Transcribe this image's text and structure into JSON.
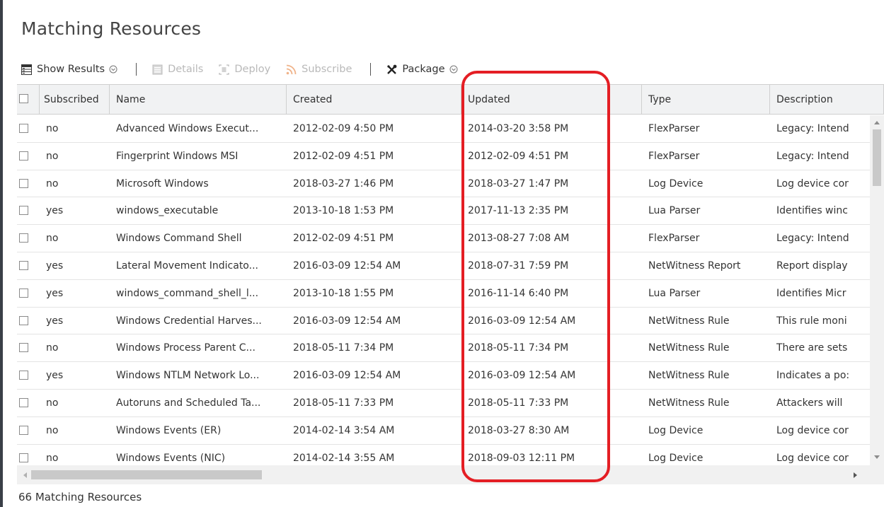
{
  "page": {
    "title": "Matching Resources",
    "footer_count": "66 Matching Resources"
  },
  "toolbar": {
    "show_results": "Show Results",
    "details": "Details",
    "deploy": "Deploy",
    "subscribe": "Subscribe",
    "package": "Package"
  },
  "columns": [
    "Subscribed",
    "Name",
    "Created",
    "Updated",
    "Type",
    "Description"
  ],
  "rows": [
    {
      "subscribed": "no",
      "name": "Advanced Windows Execut...",
      "created": "2012-02-09 4:50 PM",
      "updated": "2014-03-20 3:58 PM",
      "type": "FlexParser",
      "description": "Legacy: Intend"
    },
    {
      "subscribed": "no",
      "name": "Fingerprint Windows MSI",
      "created": "2012-02-09 4:51 PM",
      "updated": "2012-02-09 4:51 PM",
      "type": "FlexParser",
      "description": "Legacy: Intend"
    },
    {
      "subscribed": "no",
      "name": "Microsoft Windows",
      "created": "2018-03-27 1:46 PM",
      "updated": "2018-03-27 1:47 PM",
      "type": "Log Device",
      "description": "Log device cor"
    },
    {
      "subscribed": "yes",
      "name": "windows_executable",
      "created": "2013-10-18 1:53 PM",
      "updated": "2017-11-13 2:35 PM",
      "type": "Lua Parser",
      "description": "Identifies winc"
    },
    {
      "subscribed": "no",
      "name": "Windows Command Shell",
      "created": "2012-02-09 4:51 PM",
      "updated": "2013-08-27 7:08 AM",
      "type": "FlexParser",
      "description": "Legacy: Intend"
    },
    {
      "subscribed": "yes",
      "name": "Lateral Movement Indicato...",
      "created": "2016-03-09 12:54 AM",
      "updated": "2018-07-31 7:59 PM",
      "type": "NetWitness Report",
      "description": "Report display"
    },
    {
      "subscribed": "yes",
      "name": "windows_command_shell_l...",
      "created": "2013-10-18 1:55 PM",
      "updated": "2016-11-14 6:40 PM",
      "type": "Lua Parser",
      "description": "Identifies Micr"
    },
    {
      "subscribed": "yes",
      "name": "Windows Credential Harves...",
      "created": "2016-03-09 12:54 AM",
      "updated": "2016-03-09 12:54 AM",
      "type": "NetWitness Rule",
      "description": "This rule moni"
    },
    {
      "subscribed": "no",
      "name": "Windows Process Parent C...",
      "created": "2018-05-11 7:34 PM",
      "updated": "2018-05-11 7:34 PM",
      "type": "NetWitness Rule",
      "description": "There are sets"
    },
    {
      "subscribed": "yes",
      "name": "Windows NTLM Network Lo...",
      "created": "2016-03-09 12:54 AM",
      "updated": "2016-03-09 12:54 AM",
      "type": "NetWitness Rule",
      "description": "Indicates a po:"
    },
    {
      "subscribed": "no",
      "name": "Autoruns and Scheduled Ta...",
      "created": "2018-05-11 7:33 PM",
      "updated": "2018-05-11 7:33 PM",
      "type": "NetWitness Rule",
      "description": "Attackers will"
    },
    {
      "subscribed": "no",
      "name": "Windows Events (ER)",
      "created": "2014-02-14 3:54 AM",
      "updated": "2018-03-27 8:30 AM",
      "type": "Log Device",
      "description": "Log device cor"
    },
    {
      "subscribed": "no",
      "name": "Windows Events (NIC)",
      "created": "2014-02-14 3:55 AM",
      "updated": "2018-09-03 12:11 PM",
      "type": "Log Device",
      "description": "Log device cor"
    }
  ],
  "colors": {
    "highlight": "#e41e24",
    "header_bg": "#f1f2f3",
    "disabled_text": "#b9b9b9"
  },
  "icons": {
    "show_results": "grid-table-icon",
    "details": "details-icon",
    "deploy": "deploy-icon",
    "subscribe": "rss-icon",
    "package": "tools-icon"
  }
}
